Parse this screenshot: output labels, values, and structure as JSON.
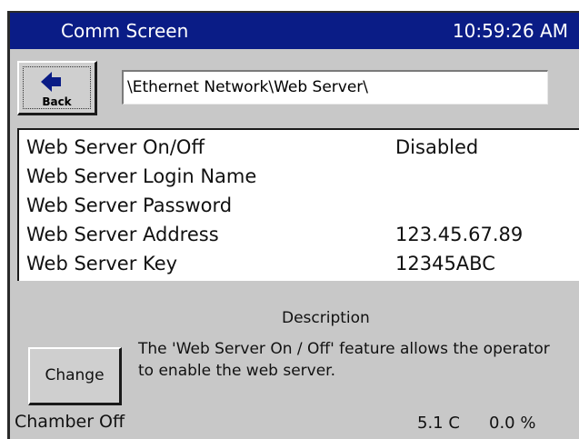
{
  "titlebar": {
    "title": "Comm Screen",
    "clock": "10:59:26 AM"
  },
  "back_button": {
    "label": "Back",
    "icon": "left-arrow-icon"
  },
  "path": "\\Ethernet Network\\Web Server\\",
  "settings": [
    {
      "name": "Web Server On/Off",
      "value": "Disabled"
    },
    {
      "name": "Web Server Login Name",
      "value": ""
    },
    {
      "name": "Web Server Password",
      "value": ""
    },
    {
      "name": "Web Server Address",
      "value": "123.45.67.89"
    },
    {
      "name": "Web Server Key",
      "value": "12345ABC"
    }
  ],
  "description": {
    "title": "Description",
    "text": "The 'Web Server On / Off' feature allows the operator to enable the web server."
  },
  "change_button": {
    "label": "Change"
  },
  "status": {
    "chamber": "Chamber Off",
    "temperature": "5.1 C",
    "percent": "0.0 %"
  },
  "colors": {
    "titlebar": "#0a1c86",
    "panel": "#c8c8c8",
    "list_bg": "#ffffff"
  }
}
